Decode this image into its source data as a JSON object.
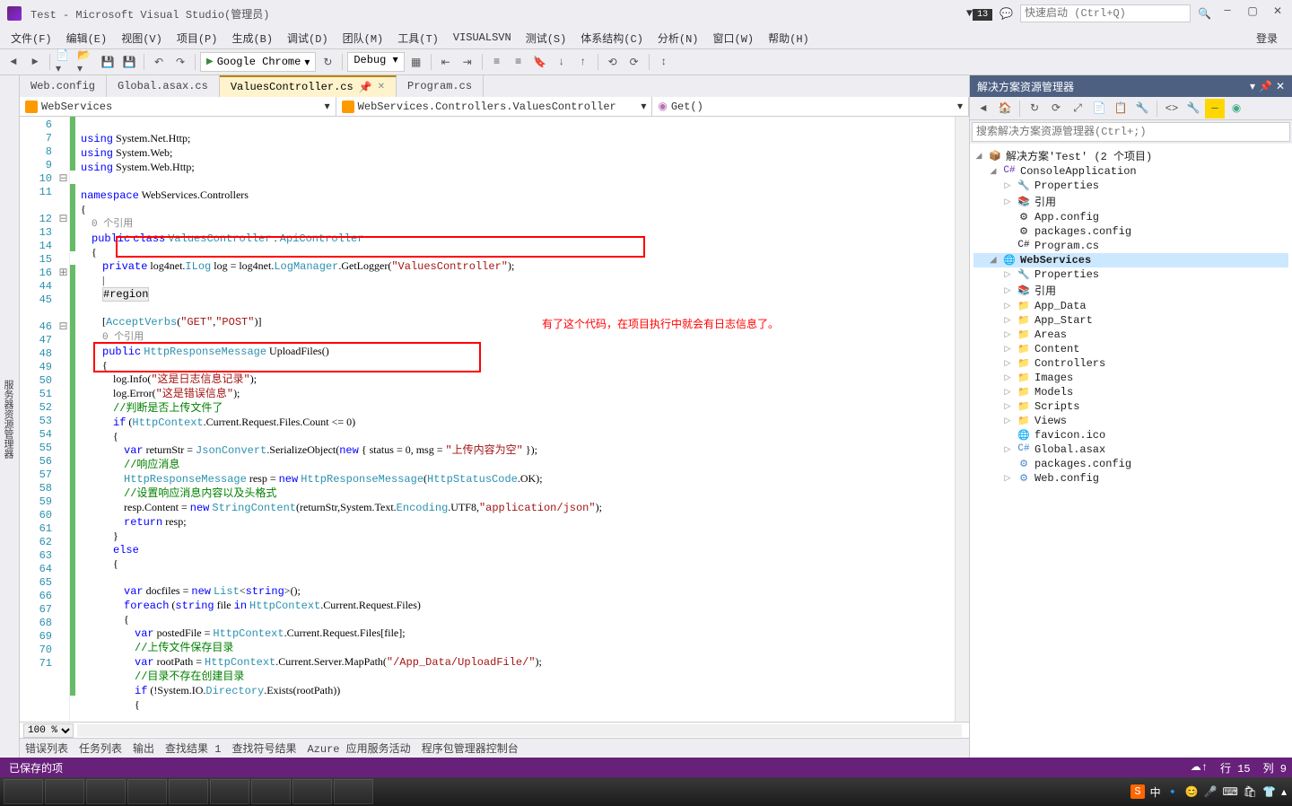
{
  "title": "Test - Microsoft Visual Studio(管理员)",
  "notifications": "13",
  "quickLaunch": "快速启动 (Ctrl+Q)",
  "menus": [
    "文件(F)",
    "编辑(E)",
    "视图(V)",
    "项目(P)",
    "生成(B)",
    "调试(D)",
    "团队(M)",
    "工具(T)",
    "VISUALSVN",
    "测试(S)",
    "体系结构(C)",
    "分析(N)",
    "窗口(W)",
    "帮助(H)"
  ],
  "login": "登录",
  "runTarget": "Google Chrome",
  "config": "Debug",
  "leftPin": "服务器资源管理器",
  "tabs": [
    {
      "label": "Web.config",
      "active": false
    },
    {
      "label": "Global.asax.cs",
      "active": false
    },
    {
      "label": "ValuesController.cs",
      "active": true,
      "pinned": true
    },
    {
      "label": "Program.cs",
      "active": false
    }
  ],
  "dropdown1": "WebServices",
  "dropdown2": "WebServices.Controllers.ValuesController",
  "dropdown3": "Get()",
  "lineNumbers": [
    "6",
    "7",
    "8",
    "9",
    "10",
    "11",
    "",
    "12",
    "13",
    "14",
    "15",
    "16",
    "44",
    "45",
    "",
    "46",
    "47",
    "48",
    "49",
    "50",
    "51",
    "52",
    "53",
    "54",
    "55",
    "56",
    "57",
    "58",
    "59",
    "60",
    "61",
    "62",
    "63",
    "64",
    "65",
    "66",
    "67",
    "68",
    "69",
    "70",
    "71"
  ],
  "fold": [
    "",
    "",
    "",
    "",
    "⊟",
    "",
    "",
    "⊟",
    "",
    "",
    "",
    "⊞",
    "",
    "",
    "",
    "⊟",
    "",
    "",
    "",
    "",
    "",
    "",
    "",
    "",
    "",
    "",
    "",
    "",
    "",
    "",
    "",
    "",
    "",
    "",
    "",
    "",
    "",
    "",
    "",
    "",
    ""
  ],
  "annotation": "有了这个代码，在项目执行中就会有日志信息了。",
  "zoom": "100 %",
  "bottomTabs": [
    "错误列表",
    "任务列表",
    "输出",
    "查找结果 1",
    "查找符号结果",
    "Azure 应用服务活动",
    "程序包管理器控制台"
  ],
  "status": {
    "saved": "已保存的项",
    "line": "行 15",
    "col": "列 9"
  },
  "solution": {
    "title": "解决方案资源管理器",
    "search": "搜索解决方案资源管理器(Ctrl+;)",
    "root": "解决方案'Test' (2 个项目)",
    "proj1": "ConsoleApplication",
    "p1items": [
      "Properties",
      "引用",
      "App.config",
      "packages.config",
      "Program.cs"
    ],
    "proj2": "WebServices",
    "p2items": [
      "Properties",
      "引用",
      "App_Data",
      "App_Start",
      "Areas",
      "Content",
      "Controllers",
      "Images",
      "Models",
      "Scripts",
      "Views",
      "favicon.ico",
      "Global.asax",
      "packages.config",
      "Web.config"
    ]
  },
  "taskbarTime": "中"
}
